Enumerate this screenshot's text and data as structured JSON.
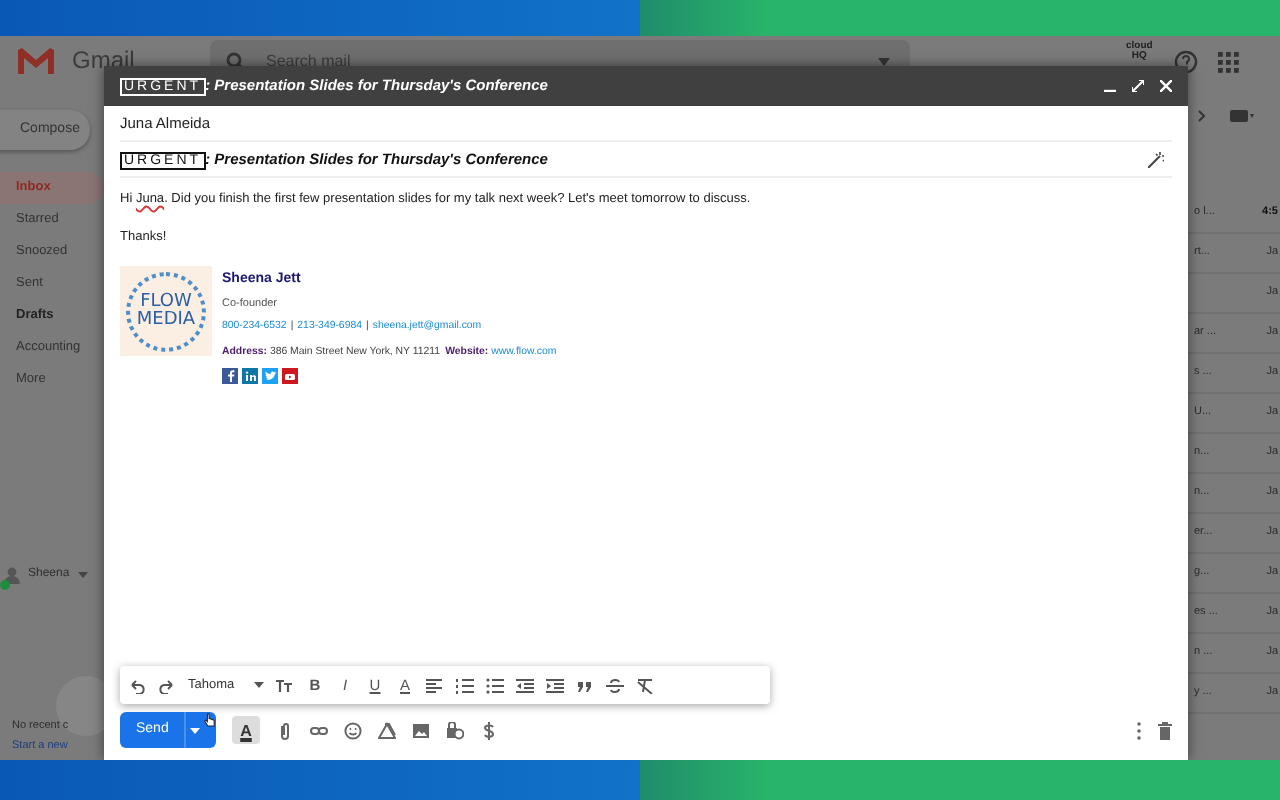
{
  "background_app": {
    "logo": "Gmail",
    "search": {
      "placeholder": "Search mail"
    },
    "addon_badge": [
      "cloud",
      "HQ"
    ],
    "compose_button": "Compose",
    "folders": [
      {
        "label": "Inbox",
        "selected": true,
        "bold": false
      },
      {
        "label": "Starred",
        "selected": false,
        "bold": false
      },
      {
        "label": "Snoozed",
        "selected": false,
        "bold": false
      },
      {
        "label": "Sent",
        "selected": false,
        "bold": false
      },
      {
        "label": "Drafts",
        "selected": false,
        "bold": true
      },
      {
        "label": "Accounting",
        "selected": false,
        "bold": false
      },
      {
        "label": "More",
        "selected": false,
        "bold": false
      }
    ],
    "chat": {
      "user": "Sheena",
      "online": true,
      "empty_text": "No recent c",
      "start_link": "Start a new"
    },
    "message_list": [
      {
        "snippet": "o l...",
        "date": "4:5",
        "unread": true
      },
      {
        "snippet": "rt...",
        "date": "Ja",
        "unread": false
      },
      {
        "date": "Ja",
        "unread": false
      },
      {
        "snippet": "ar ...",
        "date": "Ja",
        "unread": false
      },
      {
        "snippet": "s ...",
        "date": "Ja",
        "unread": false
      },
      {
        "snippet": "U...",
        "date": "Ja",
        "unread": false
      },
      {
        "snippet": "n...",
        "date": "Ja",
        "unread": false
      },
      {
        "snippet": "n...",
        "date": "Ja",
        "unread": false
      },
      {
        "snippet": "er...",
        "date": "Ja",
        "unread": false
      },
      {
        "snippet": "g...",
        "date": "Ja",
        "unread": false
      },
      {
        "snippet": "es ...",
        "date": "Ja",
        "unread": false
      },
      {
        "snippet": "n ...",
        "date": "Ja",
        "unread": false
      },
      {
        "snippet": "y ...",
        "date": "Ja",
        "unread": false
      }
    ]
  },
  "compose": {
    "title": {
      "tag": "URGENT",
      "text": ": Presentation Slides for Thursday's Conference"
    },
    "recipient": "Juna Almeida",
    "subject": {
      "tag": "URGENT",
      "text": ": Presentation Slides for Thursday's Conference"
    },
    "body": [
      {
        "before": "Hi ",
        "misspelled": "Juna",
        "after": ". Did you finish the first few presentation slides for my talk next week? Let's meet tomorrow to discuss."
      },
      {
        "before": "Thanks!"
      }
    ],
    "signature": {
      "logo": [
        "FLOW",
        "MEDIA"
      ],
      "name": "Sheena Jett",
      "role": "Co-founder",
      "contacts": [
        "800-234-6532",
        "213-349-6984",
        "sheena.jett@gmail.com"
      ],
      "separator": "|",
      "address_label": "Address:",
      "address": "386 Main Street New York, NY 11211",
      "website_label": "Website:",
      "website": "www.flow.com",
      "socials": [
        {
          "color": "#3b5998"
        },
        {
          "color": "#0e76a8"
        },
        {
          "color": "#1da1f2"
        },
        {
          "color": "#cc181e"
        }
      ]
    },
    "toolbar": {
      "font": "Tahoma",
      "letters": [
        "B",
        "I",
        "U",
        "A"
      ]
    },
    "send_button": "Send",
    "formatting_toggle": {
      "label": "A",
      "selected": true
    }
  }
}
